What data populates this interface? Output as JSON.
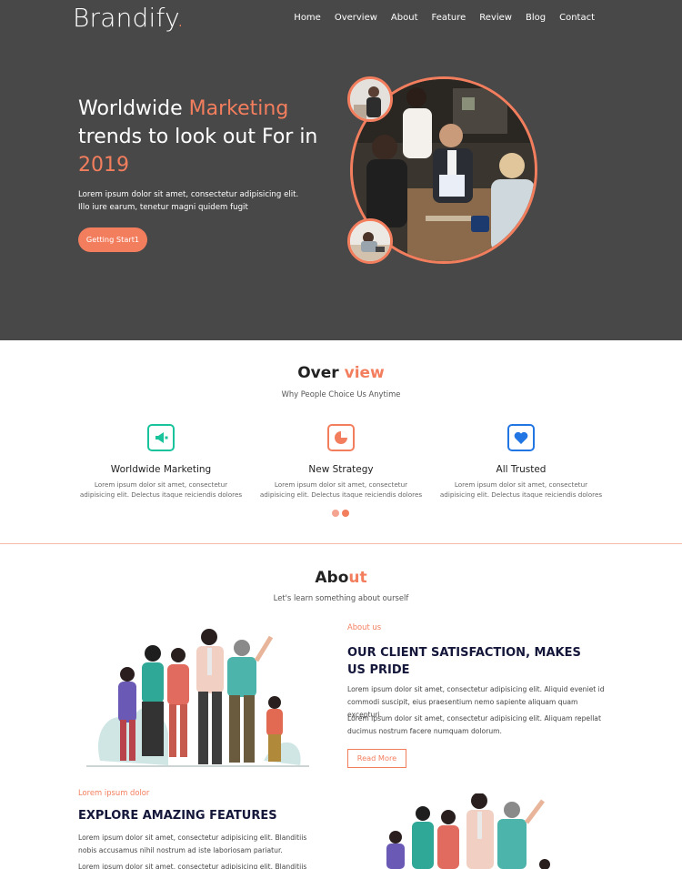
{
  "brand": {
    "name": "Brandify",
    "dot": "."
  },
  "nav": [
    "Home",
    "Overview",
    "About",
    "Feature",
    "Review",
    "Blog",
    "Contact"
  ],
  "hero": {
    "title_part1": "Worldwide ",
    "title_accent1": "Marketing",
    "title_part2": " trends to look out For in ",
    "title_accent2": "2019",
    "text": "Lorem ipsum dolor sit amet, consectetur adipisicing elit. Illo iure earum, tenetur magni quidem fugit",
    "button": "Getting Start1"
  },
  "overview": {
    "title_plain": "Over ",
    "title_accent": "view",
    "subtitle": "Why People Choice Us Anytime",
    "features": [
      {
        "name": "Worldwide Marketing",
        "desc": "Lorem ipsum dolor sit amet, consectetur adipisicing elit. Delectus itaque reiciendis dolores",
        "icon": "megaphone-icon",
        "color": "#19c39c"
      },
      {
        "name": "New Strategy",
        "desc": "Lorem ipsum dolor sit amet, consectetur adipisicing elit. Delectus itaque reiciendis dolores",
        "icon": "pie-chart-icon",
        "color": "#f37e5e"
      },
      {
        "name": "All Trusted",
        "desc": "Lorem ipsum dolor sit amet, consectetur adipisicing elit. Delectus itaque reiciendis dolores",
        "icon": "heart-icon",
        "color": "#2276e3"
      }
    ]
  },
  "about": {
    "title_plain": "Abo",
    "title_accent": "ut",
    "subtitle": "Let's learn something about ourself",
    "label": "About us",
    "heading": "OUR CLIENT SATISFACTION, MAKES US PRIDE",
    "p1": "Lorem ipsum dolor sit amet, consectetur adipisicing elit. Aliquid eveniet id commodi suscipit, eius praesentium nemo sapiente aliquam quam excepturi.",
    "p2": "Lorem ipsum dolor sit amet, consectetur adipisicing elit. Aliquam repellat ducimus nostrum facere numquam dolorum.",
    "button": "Read More"
  },
  "features_section": {
    "label": "Lorem ipsum dolor",
    "heading": "EXPLORE AMAZING FEATURES",
    "p1": "Lorem ipsum dolor sit amet, consectetur adipisicing elit. Blanditiis nobis accusamus nihil nostrum ad iste laboriosam pariatur.",
    "p2": "Lorem ipsum dolor sit amet, consectetur adipisicing elit. Blanditiis nobis"
  },
  "colors": {
    "accent": "#f37e5e",
    "hero_bg": "#484848",
    "navy": "#14163a"
  }
}
